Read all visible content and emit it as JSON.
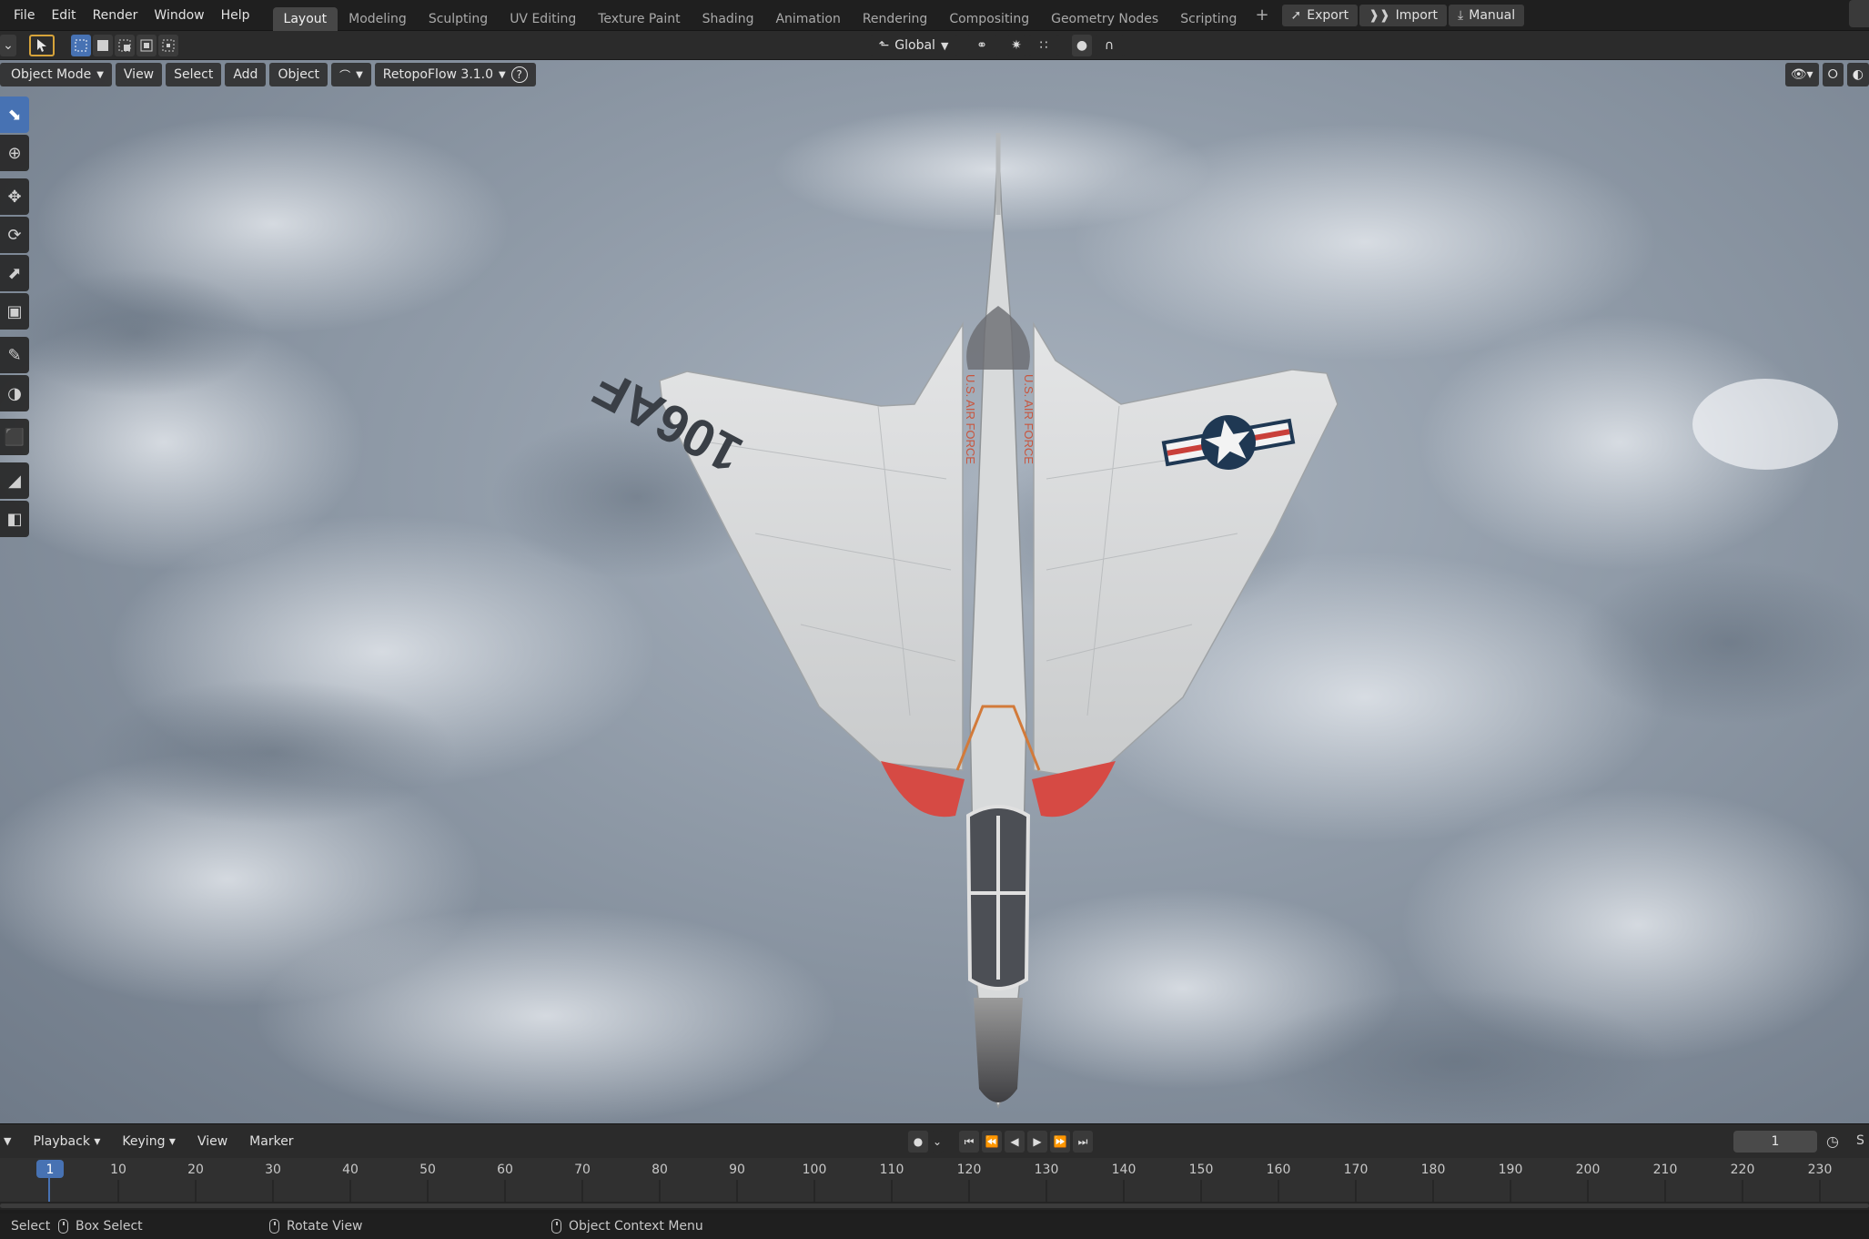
{
  "topbar": {
    "menus": [
      "File",
      "Edit",
      "Render",
      "Window",
      "Help"
    ],
    "workspaces": [
      "Layout",
      "Modeling",
      "Sculpting",
      "UV Editing",
      "Texture Paint",
      "Shading",
      "Animation",
      "Rendering",
      "Compositing",
      "Geometry Nodes",
      "Scripting"
    ],
    "active_workspace": "Layout",
    "add_workspace": "+",
    "buttons": {
      "export": "Export",
      "import": "Import",
      "manual": "Manual"
    }
  },
  "tool_header": {
    "orientation": "Global"
  },
  "viewport": {
    "mode": "Object Mode",
    "menus": [
      "View",
      "Select",
      "Add",
      "Object"
    ],
    "addon": "RetopoFlow 3.1.0",
    "help": "?",
    "aircraft_tail_number": "106AF",
    "aircraft_side_text": "U.S. AIR FORCE"
  },
  "timeline": {
    "menus": [
      "Playback",
      "Keying",
      "View",
      "Marker"
    ],
    "current_frame": "1",
    "ruler_marks": [
      "1",
      "10",
      "20",
      "30",
      "40",
      "50",
      "60",
      "70",
      "80",
      "90",
      "100",
      "110",
      "120",
      "130",
      "140",
      "150",
      "160",
      "170",
      "180",
      "190",
      "200",
      "210",
      "220",
      "230"
    ]
  },
  "statusbar": {
    "select": "Select",
    "box_select": "Box Select",
    "rotate_view": "Rotate View",
    "context_menu": "Object Context Menu"
  },
  "colors": {
    "accent_blue": "#4772b3",
    "active_tool_outline": "#d6a33a",
    "panel_dark": "#1f1f1f",
    "panel_mid": "#2b2b2b"
  }
}
